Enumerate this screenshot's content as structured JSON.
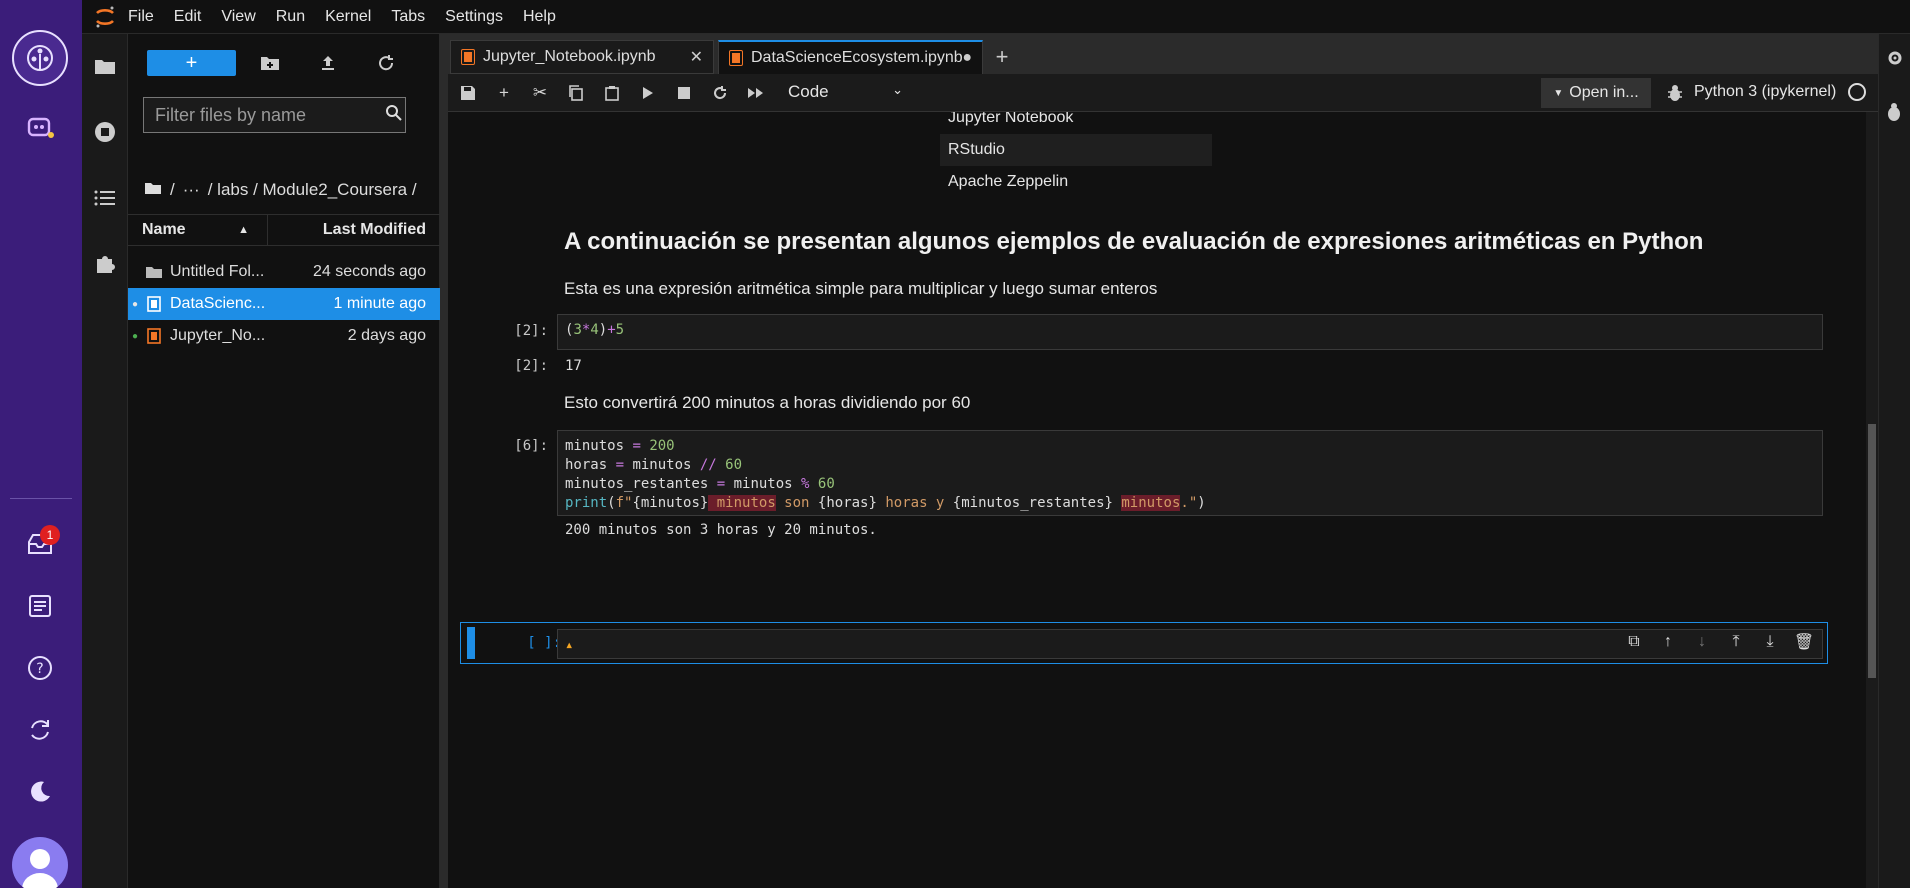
{
  "menu": [
    "File",
    "Edit",
    "View",
    "Run",
    "Kernel",
    "Tabs",
    "Settings",
    "Help"
  ],
  "notifications_count": "1",
  "file_browser": {
    "new_label": "+",
    "filter_placeholder": "Filter files by name",
    "breadcrumb": [
      "/",
      "···",
      "/ labs / Module2_Coursera /"
    ],
    "col_name": "Name",
    "col_modified": "Last Modified",
    "files": [
      {
        "name": "Untitled Fol...",
        "modified": "24 seconds ago",
        "type": "folder"
      },
      {
        "name": "DataScienc...",
        "modified": "1 minute ago",
        "type": "notebook"
      },
      {
        "name": "Jupyter_No...",
        "modified": "2 days ago",
        "type": "notebook"
      }
    ]
  },
  "tabs": [
    {
      "label": "Jupyter_Notebook.ipynb",
      "close": "✕"
    },
    {
      "label": "DataScienceEcosystem.ipynb",
      "close": "●"
    }
  ],
  "toolbar": {
    "cell_type": "Code",
    "open_in": "Open in...",
    "kernel": "Python 3 (ipykernel)"
  },
  "notebook": {
    "list_items": [
      "Jupyter Notebook",
      "RStudio",
      "Apache Zeppelin"
    ],
    "heading": "A continuación se presentan algunos ejemplos de evaluación de expresiones aritméticas en Python",
    "para1": "Esta es una expresión aritmética simple para multiplicar y luego sumar enteros",
    "cell2_prompt": "[2]:",
    "cell2_out_prompt": "[2]:",
    "cell2_output": "17",
    "para2": "Esto convertirá 200 minutos a horas dividiendo por 60",
    "cell6_prompt": "[6]:",
    "cell6_output": "200 minutos son 3 horas y 20 minutos.",
    "empty_prompt": "[ ]:"
  }
}
